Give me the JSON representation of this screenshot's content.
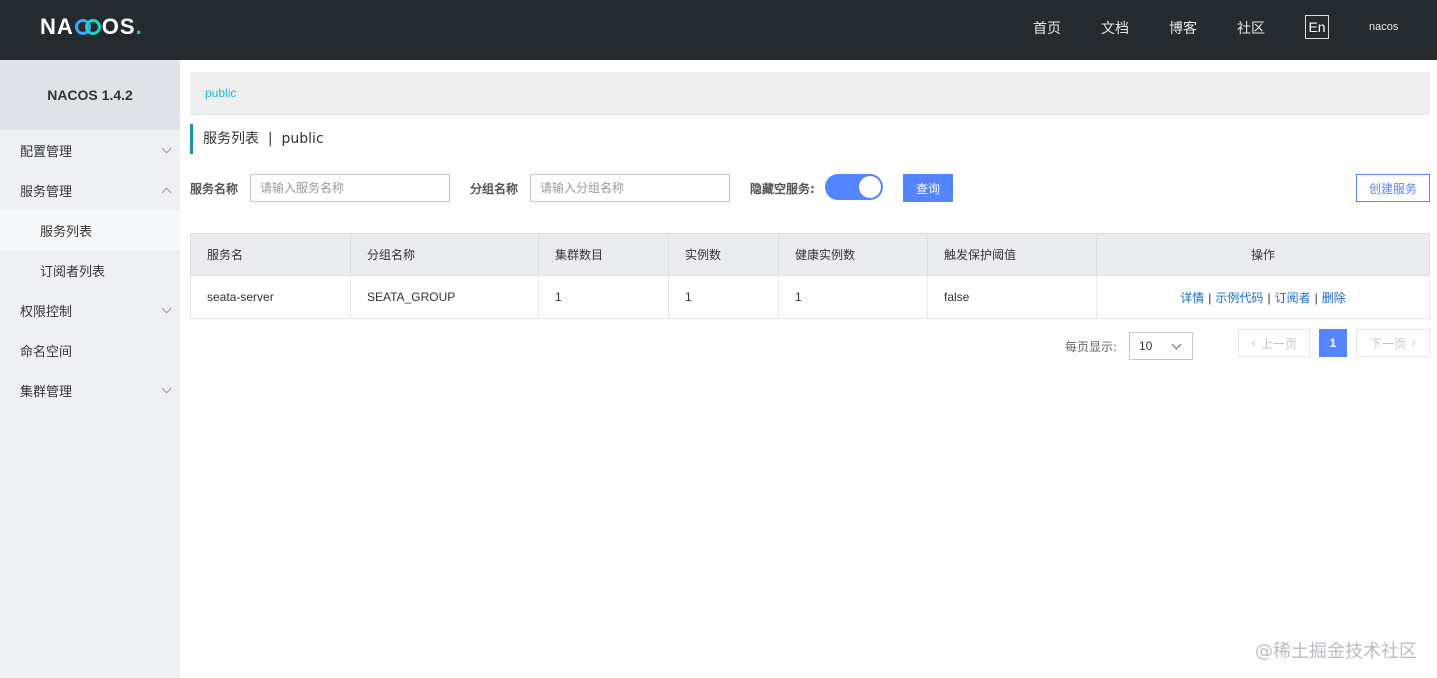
{
  "header": {
    "logo_pre": "NA",
    "logo_post": "OS",
    "logo_dot": ".",
    "nav": [
      "首页",
      "文档",
      "博客",
      "社区"
    ],
    "lang": "En",
    "user": "nacos"
  },
  "sidebar": {
    "version": "NACOS 1.4.2",
    "items": [
      {
        "label": "配置管理"
      },
      {
        "label": "服务管理"
      },
      {
        "label": "服务列表"
      },
      {
        "label": "订阅者列表"
      },
      {
        "label": "权限控制"
      },
      {
        "label": "命名空间"
      },
      {
        "label": "集群管理"
      }
    ]
  },
  "namespace": {
    "current": "public"
  },
  "page": {
    "title": "服务列表  |  public"
  },
  "filters": {
    "service_label": "服务名称",
    "service_placeholder": "请输入服务名称",
    "group_label": "分组名称",
    "group_placeholder": "请输入分组名称",
    "hide_empty_label": "隐藏空服务:",
    "hide_empty_on": true,
    "query_button": "查询",
    "create_button": "创建服务"
  },
  "table": {
    "columns": [
      "服务名",
      "分组名称",
      "集群数目",
      "实例数",
      "健康实例数",
      "触发保护阈值",
      "操作"
    ],
    "rows": [
      {
        "name": "seata-server",
        "group": "SEATA_GROUP",
        "clusters": "1",
        "instances": "1",
        "healthy": "1",
        "threshold": "false"
      }
    ],
    "actions": [
      "详情",
      "示例代码",
      "订阅者",
      "删除"
    ],
    "separator": "|"
  },
  "pagination": {
    "page_size_label": "每页显示:",
    "page_size": "10",
    "prev": "上一页",
    "next": "下一页",
    "current": "1"
  },
  "watermark": "@稀土掘金技术社区"
}
